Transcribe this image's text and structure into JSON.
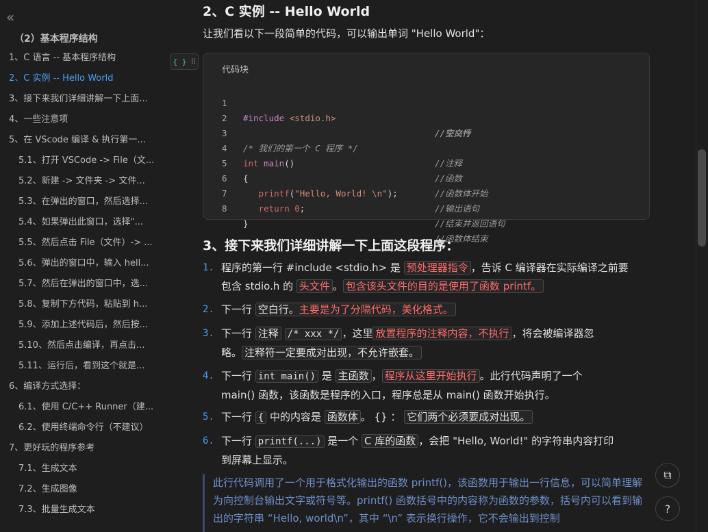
{
  "sidebar": {
    "collapse_glyph": "«",
    "title": "（2）基本程序结构",
    "items": [
      {
        "label": "1、C 语言 -- 基本程序结构",
        "active": false
      },
      {
        "label": "2、C 实例 -- Hello World",
        "active": true
      },
      {
        "label": "3、接下来我们详细讲解一下上面...",
        "active": false
      },
      {
        "label": "4、一些注意项",
        "active": false
      },
      {
        "label": "5、在 VScode 编译 & 执行第一...",
        "active": false
      },
      {
        "label": "5.1、打开 VSCode -> File（文...",
        "active": false
      },
      {
        "label": "5.2、新建 -> 文件夹 -> 文件...",
        "active": false
      },
      {
        "label": "5.3、在弹出的窗口，然后选择...",
        "active": false
      },
      {
        "label": "5.4、如果弹出此窗口，选择\"...",
        "active": false
      },
      {
        "label": "5.5、然后点击 File（文件）-> ...",
        "active": false
      },
      {
        "label": "5.6、弹出的窗口中，输入 hell...",
        "active": false
      },
      {
        "label": "5.7、然后在弹出的窗口中，选...",
        "active": false
      },
      {
        "label": "5.8、复制下方代码，粘贴到 h...",
        "active": false
      },
      {
        "label": "5.9、添加上述代码后，然后按...",
        "active": false
      },
      {
        "label": "5.10、然后点击编译，再点击...",
        "active": false
      },
      {
        "label": "5.11、运行后，看到这个就是...",
        "active": false
      },
      {
        "label": "6、编译方式选择：",
        "active": false
      },
      {
        "label": "6.1、使用 C/C++ Runner（建...",
        "active": false
      },
      {
        "label": "6.2、使用终端命令行（不建议）",
        "active": false
      },
      {
        "label": "7、更好玩的程序参考",
        "active": false
      },
      {
        "label": "7.1、生成文本",
        "active": false
      },
      {
        "label": "7.2、生成图像",
        "active": false
      },
      {
        "label": "7.3、批量生成文本",
        "active": false
      }
    ]
  },
  "section2": {
    "heading": "2、C 实例 -- Hello World",
    "intro": "让我们看以下一段简单的代码，可以输出单词 \"Hello World\"："
  },
  "block_handle": {
    "brace": "{ }",
    "grip": "⠿"
  },
  "codeblock": {
    "label": "代码块",
    "lines": [
      {
        "n": "1",
        "comment": "//头文件"
      },
      {
        "n": "2",
        "comment": "//空白行"
      },
      {
        "n": "3",
        "comment": "//注释"
      },
      {
        "n": "4",
        "comment": "//函数"
      },
      {
        "n": "5",
        "comment": "//函数体开始"
      },
      {
        "n": "6",
        "comment": "//输出语句"
      },
      {
        "n": "7",
        "comment": "//结束并返回语句"
      },
      {
        "n": "8",
        "comment": "//函数体结束"
      }
    ],
    "src": {
      "l1_a": "#include",
      "l1_b": " <stdio.h>",
      "l3": "/* 我们的第一个 C 程序 */",
      "l4_a": "int",
      "l4_b": " main",
      "l4_c": "()",
      "l5": "{",
      "l6_a": "   printf",
      "l6_b": "(",
      "l6_c": "\"Hello, World! \\n\"",
      "l6_d": ");",
      "l7_a": "   return",
      "l7_b": " 0",
      "l7_c": ";",
      "l8": "}"
    }
  },
  "section3": {
    "heading": "3、接下来我们详细讲解一下上面这段程序：",
    "p1": {
      "num": "1.",
      "a": "程序的第一行 #include <stdio.h> 是 ",
      "tag1": "预处理器指令",
      "b": "，告诉 C 编译器在实际编译之前要",
      "c": "包含 stdio.h 的 ",
      "tag2": "头文件",
      "d": "。",
      "tag3": "包含该头文件的目的是使用了函数 printf。"
    },
    "p2": {
      "num": "2.",
      "a": "下一行 ",
      "tag1a": "空白行。",
      "tag1b": "主要是为了分隔代码，美化格式。"
    },
    "p3": {
      "num": "3.",
      "a": "下一行 ",
      "tag1": "注释",
      "b": " ",
      "tag2": "/* xxx */",
      "c": "，这里",
      "tag3": "放置程序的注释内容，不执行",
      "d": "，将会被编译器忽",
      "e": "略。",
      "tag4": "注释符一定要成对出现，不允许嵌套。"
    },
    "p4": {
      "num": "4.",
      "a": "下一行 ",
      "tag1": "int main()",
      "b": " 是 ",
      "tag2": "主函数",
      "c": "，",
      "tag3": "程序从这里开始执行",
      "d": "。此行代码声明了一个",
      "e": "main() 函数，该函数是程序的入口，程序总是从 main() 函数开始执行。"
    },
    "p5": {
      "num": "5.",
      "a": "下一行 ",
      "tag1": "{",
      "b": " 中的内容是 ",
      "tag2": "函数体",
      "c": "。 {} ： ",
      "tag3": "它们两个必须要成对出现。"
    },
    "p6": {
      "num": "6.",
      "a": "下一行 ",
      "tag1": "printf(...)",
      "b": " 是一个 ",
      "tag2": "C 库的函数",
      "c": "，会把 \"Hello, World!\" 的字符串内容打印",
      "d": "到屏幕上显示。"
    },
    "quote": "此行代码调用了一个用于格式化输出的函数 printf()，该函数用于输出一行信息，可以简单理解为向控制台输出文字或符号等。printf() 函数括号中的内容称为函数的参数，括号内可以看到输出的字符串 “Hello, world\\n”，其中 “\\n” 表示换行操作，它不会输出到控制"
  },
  "fabs": {
    "copy_icon_glyph": "⧉",
    "help_glyph": "?"
  },
  "colors": {
    "accent": "#4a9df8",
    "highlight_red": "#ff6b6b",
    "quote": "#6d8fc9"
  }
}
